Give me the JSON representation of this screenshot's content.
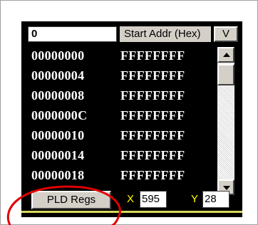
{
  "start_addr": {
    "value": "0",
    "label": "Start Addr (Hex)"
  },
  "v_button": {
    "label": "V"
  },
  "memory_rows": [
    {
      "addr": "00000000",
      "value": "FFFFFFFF"
    },
    {
      "addr": "00000004",
      "value": "FFFFFFFF"
    },
    {
      "addr": "00000008",
      "value": "FFFFFFFF"
    },
    {
      "addr": "0000000C",
      "value": "FFFFFFFF"
    },
    {
      "addr": "00000010",
      "value": "FFFFFFFF"
    },
    {
      "addr": "00000014",
      "value": "FFFFFFFF"
    },
    {
      "addr": "00000018",
      "value": "FFFFFFFF"
    }
  ],
  "bottom_bar": {
    "pld_button_label": "PLD Regs",
    "x_label": "X",
    "x_value": "595",
    "y_label": "Y",
    "y_value": "28"
  },
  "colors": {
    "panel_bg": "#000000",
    "row_text": "#ffffff",
    "coord_label": "#ffff00",
    "annotation": "#e00000"
  },
  "icons": {
    "scroll_up": "arrow-up-icon",
    "scroll_down": "arrow-down-icon"
  }
}
